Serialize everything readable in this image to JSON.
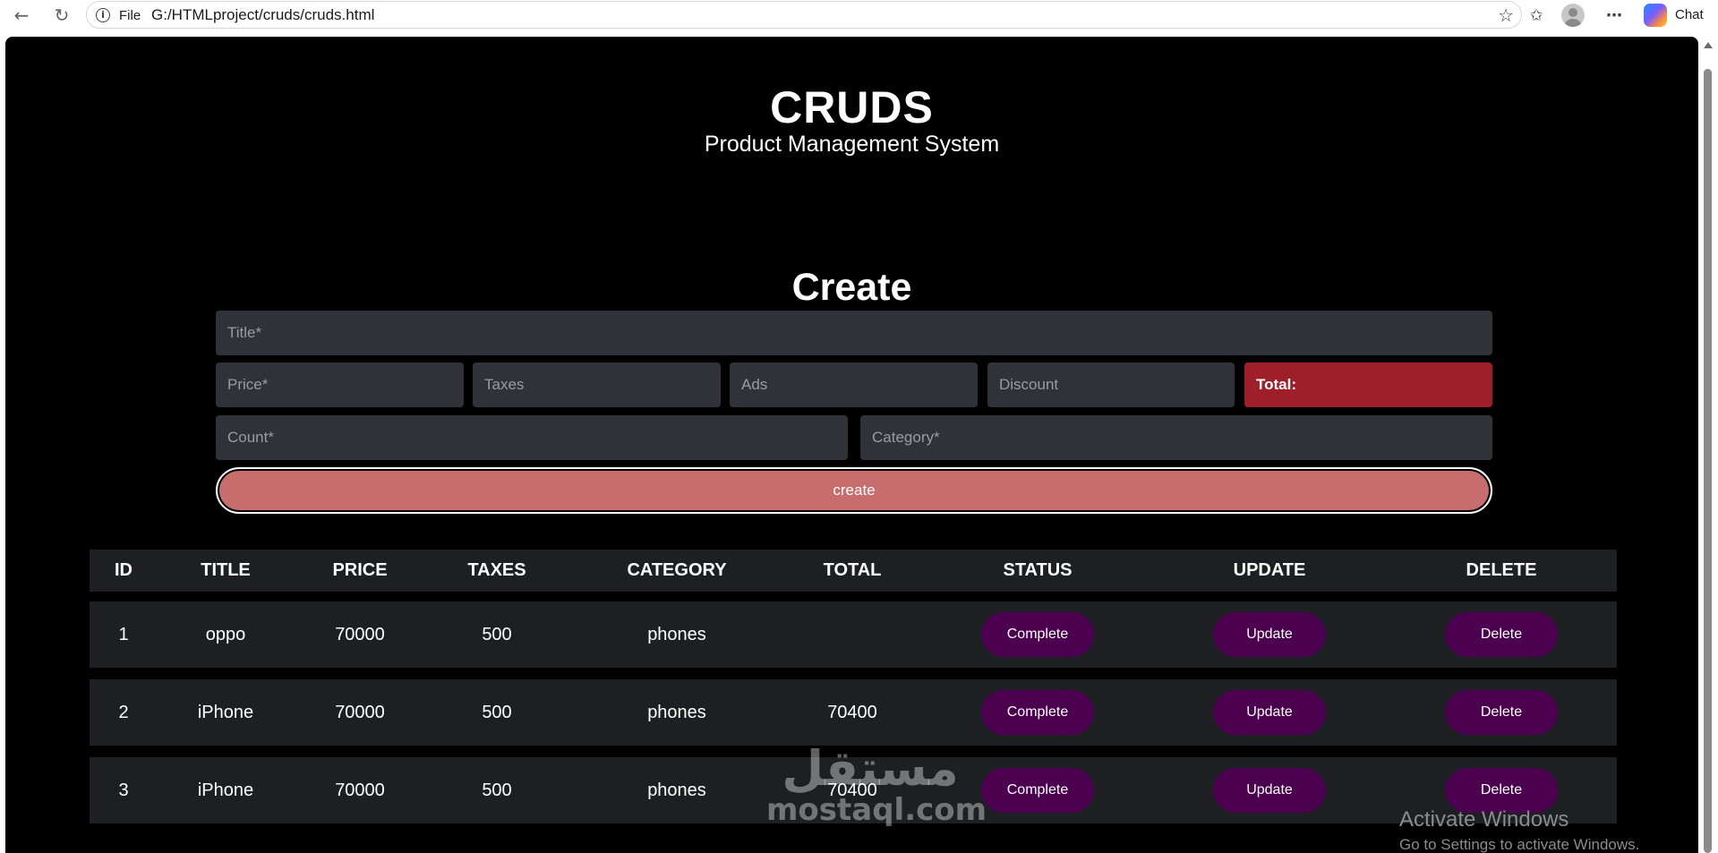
{
  "browser": {
    "scheme_label": "File",
    "url": "G:/HTMLproject/cruds/cruds.html",
    "chat_label": "Chat",
    "icons": [
      "back-arrow-icon",
      "reload-icon",
      "info-icon",
      "star-icon",
      "favorites-icon",
      "profile-icon",
      "more-icon",
      "copilot-icon"
    ]
  },
  "header": {
    "title": "CRUDS",
    "subtitle": "Product Management System"
  },
  "form": {
    "heading": "Create",
    "title_placeholder": "Title*",
    "price_placeholder": "Price*",
    "taxes_placeholder": "Taxes",
    "ads_placeholder": "Ads",
    "discount_placeholder": "Discount",
    "total_label": "Total:",
    "count_placeholder": "Count*",
    "category_placeholder": "Category*",
    "submit_label": "create",
    "total_color": "#9e1f2a",
    "submit_color": "#c76d6d"
  },
  "table": {
    "headers": [
      "ID",
      "TITLE",
      "PRICE",
      "TAXES",
      "CATEGORY",
      "TOTAL",
      "STATUS",
      "UPDATE",
      "DELETE"
    ],
    "rows": [
      {
        "id": "1",
        "title": "oppo",
        "price": "70000",
        "taxes": "500",
        "category": "phones",
        "total": "",
        "status": "Complete",
        "update": "Update",
        "delete": "Delete"
      },
      {
        "id": "2",
        "title": "iPhone",
        "price": "70000",
        "taxes": "500",
        "category": "phones",
        "total": "70400",
        "status": "Complete",
        "update": "Update",
        "delete": "Delete"
      },
      {
        "id": "3",
        "title": "iPhone",
        "price": "70000",
        "taxes": "500",
        "category": "phones",
        "total": "70400",
        "status": "Complete",
        "update": "Update",
        "delete": "Delete"
      }
    ],
    "button_color": "#4b0050"
  },
  "watermark": {
    "arabic": "مستقل",
    "latin": "mostaql.com"
  },
  "os_overlay": {
    "line1": "Activate Windows",
    "line2": "Go to Settings to activate Windows."
  }
}
